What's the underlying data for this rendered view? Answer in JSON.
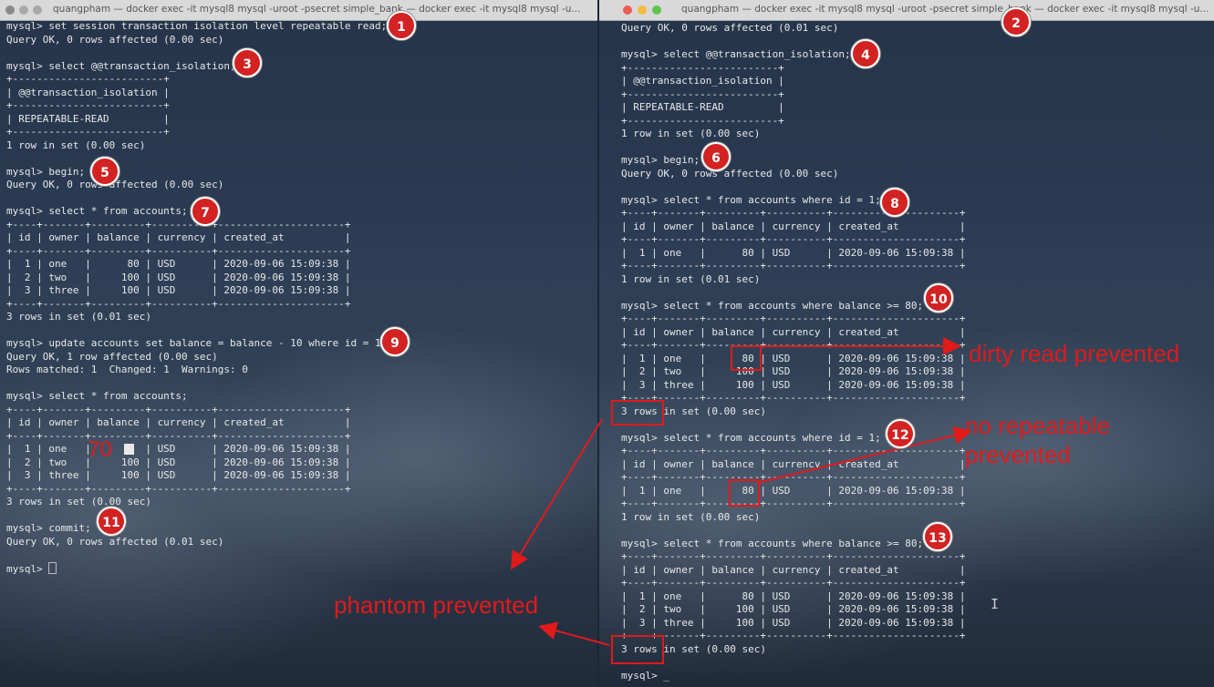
{
  "windows": {
    "left": {
      "title": "quangpham — docker exec -it mysql8 mysql -uroot -psecret simple_bank — docker exec -it mysql8 mysql -u...",
      "lines": [
        "mysql> set session transaction isolation level repeatable read;",
        "Query OK, 0 rows affected (0.00 sec)",
        "",
        "mysql> select @@transaction_isolation;",
        "+-------------------------+",
        "| @@transaction_isolation |",
        "+-------------------------+",
        "| REPEATABLE-READ         |",
        "+-------------------------+",
        "1 row in set (0.00 sec)",
        "",
        "mysql> begin;",
        "Query OK, 0 rows affected (0.00 sec)",
        "",
        "mysql> select * from accounts;",
        "+----+-------+---------+----------+---------------------+",
        "| id | owner | balance | currency | created_at          |",
        "+----+-------+---------+----------+---------------------+",
        "|  1 | one   |      80 | USD      | 2020-09-06 15:09:38 |",
        "|  2 | two   |     100 | USD      | 2020-09-06 15:09:38 |",
        "|  3 | three |     100 | USD      | 2020-09-06 15:09:38 |",
        "+----+-------+---------+----------+---------------------+",
        "3 rows in set (0.01 sec)",
        "",
        "mysql> update accounts set balance = balance - 10 where id = 1;",
        "Query OK, 1 row affected (0.00 sec)",
        "Rows matched: 1  Changed: 1  Warnings: 0",
        "",
        "mysql> select * from accounts;",
        "+----+-------+---------+----------+---------------------+",
        "| id | owner | balance | currency | created_at          |",
        "+----+-------+---------+----------+---------------------+",
        "|  1 | one   |         | USD      | 2020-09-06 15:09:38 |",
        "|  2 | two   |     100 | USD      | 2020-09-06 15:09:38 |",
        "|  3 | three |     100 | USD      | 2020-09-06 15:09:38 |",
        "+----+-------+---------+----------+---------------------+",
        "3 rows in set (0.00 sec)",
        "",
        "mysql> commit;",
        "Query OK, 0 rows affected (0.01 sec)",
        "",
        "mysql> "
      ]
    },
    "right": {
      "title": "quangpham — docker exec -it mysql8 mysql -uroot -psecret simple_bank — docker exec -it mysql8 mysql -u...",
      "lines": [
        "Query OK, 0 rows affected (0.01 sec)",
        "",
        "mysql> select @@transaction_isolation;",
        "+-------------------------+",
        "| @@transaction_isolation |",
        "+-------------------------+",
        "| REPEATABLE-READ         |",
        "+-------------------------+",
        "1 row in set (0.00 sec)",
        "",
        "mysql> begin;",
        "Query OK, 0 rows affected (0.00 sec)",
        "",
        "mysql> select * from accounts where id = 1;",
        "+----+-------+---------+----------+---------------------+",
        "| id | owner | balance | currency | created_at          |",
        "+----+-------+---------+----------+---------------------+",
        "|  1 | one   |      80 | USD      | 2020-09-06 15:09:38 |",
        "+----+-------+---------+----------+---------------------+",
        "1 row in set (0.01 sec)",
        "",
        "mysql> select * from accounts where balance >= 80;",
        "+----+-------+---------+----------+---------------------+",
        "| id | owner | balance | currency | created_at          |",
        "+----+-------+---------+----------+---------------------+",
        "|  1 | one   |      80 | USD      | 2020-09-06 15:09:38 |",
        "|  2 | two   |     100 | USD      | 2020-09-06 15:09:38 |",
        "|  3 | three |     100 | USD      | 2020-09-06 15:09:38 |",
        "+----+-------+---------+----------+---------------------+",
        "3 rows in set (0.00 sec)",
        "",
        "mysql> select * from accounts where id = 1;",
        "+----+-------+---------+----------+---------------------+",
        "| id | owner | balance | currency | created_at          |",
        "+----+-------+---------+----------+---------------------+",
        "|  1 | one   |      80 | USD      | 2020-09-06 15:09:38 |",
        "+----+-------+---------+----------+---------------------+",
        "1 row in set (0.00 sec)",
        "",
        "mysql> select * from accounts where balance >= 80;",
        "+----+-------+---------+----------+---------------------+",
        "| id | owner | balance | currency | created_at          |",
        "+----+-------+---------+----------+---------------------+",
        "|  1 | one   |      80 | USD      | 2020-09-06 15:09:38 |",
        "|  2 | two   |     100 | USD      | 2020-09-06 15:09:38 |",
        "|  3 | three |     100 | USD      | 2020-09-06 15:09:38 |",
        "+----+-------+---------+----------+---------------------+",
        "3 rows in set (0.00 sec)",
        "",
        "mysql> _"
      ]
    }
  },
  "badges": [
    "1",
    "2",
    "3",
    "4",
    "5",
    "6",
    "7",
    "8",
    "9",
    "10",
    "11",
    "12",
    "13"
  ],
  "annotations": {
    "dirty_read": "dirty read prevented",
    "no_repeatable": "no repeatable\nprevented",
    "phantom": "phantom prevented",
    "handwritten_value": "70"
  },
  "colors": {
    "accent": "#e11a1a",
    "terminal_text": "#e8e8e8",
    "badge": "#d32222"
  }
}
